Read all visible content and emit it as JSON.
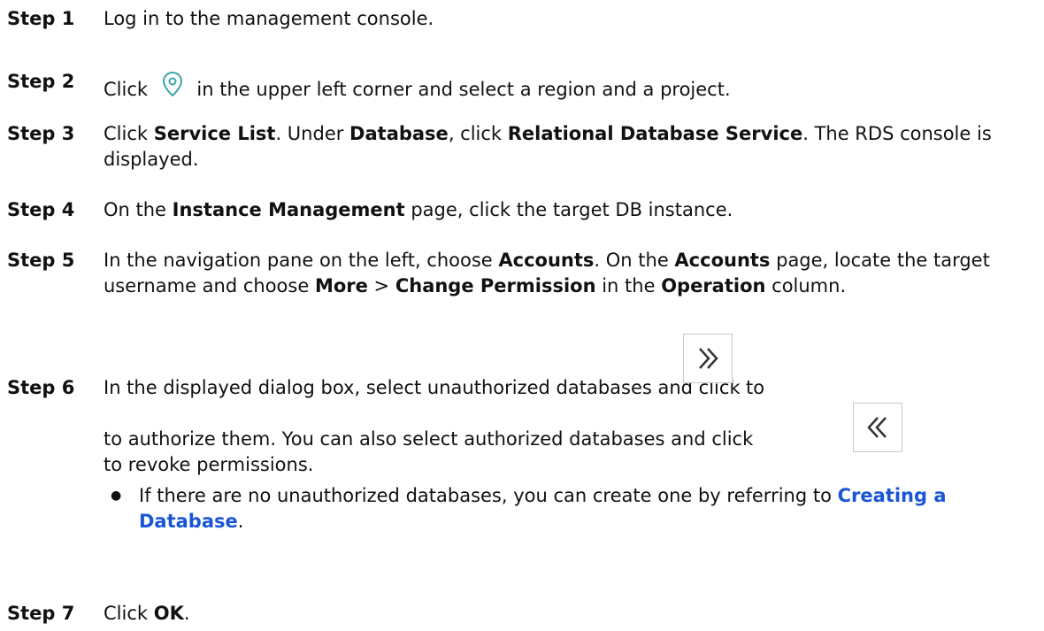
{
  "steps": [
    {
      "label": "Step 1",
      "text": "Log in to the management console."
    },
    {
      "label": "Step 2",
      "before": "Click",
      "icon": "location-pin-icon",
      "after": "in the upper left corner and select a region and a project."
    },
    {
      "label": "Step 3",
      "p1": "Click ",
      "b1": "Service List",
      "p2": ". Under ",
      "b2": "Database",
      "p3": ", click ",
      "b3": "Relational Database Service",
      "p4": ". The RDS console is displayed."
    },
    {
      "label": "Step 4",
      "p1": "On the ",
      "b1": "Instance Management",
      "p2": " page, click the target DB instance."
    },
    {
      "label": "Step 5",
      "p1": "In the navigation pane on the left, choose ",
      "b1": "Accounts",
      "p2": ". On the ",
      "b2": "Accounts",
      "p3": " page, locate the target username and choose ",
      "b3": "More",
      "p4": " > ",
      "b4": "Change Permission",
      "p5": " in the ",
      "b5": "Operation",
      "p6": " column."
    },
    {
      "label": "Step 6",
      "p1": "In the displayed dialog box, select unauthorized databases and click",
      "p2": "to authorize them. You can also select authorized databases and click",
      "p3": "to revoke permissions.",
      "add_icon": "double-chevron-right-icon",
      "remove_icon": "double-chevron-left-icon",
      "bullet": "●",
      "note": "If there are no unauthorized databases, you can create one by referring to ",
      "note_link": "Creating a Database",
      "note_end": "."
    },
    {
      "label": "Step 7",
      "p1": "Click ",
      "b1": "OK",
      "p2": "."
    }
  ],
  "colors": {
    "link": "#1a55d6",
    "icon_stroke": "#3aa6a6",
    "button_border": "#c8c8c8"
  }
}
